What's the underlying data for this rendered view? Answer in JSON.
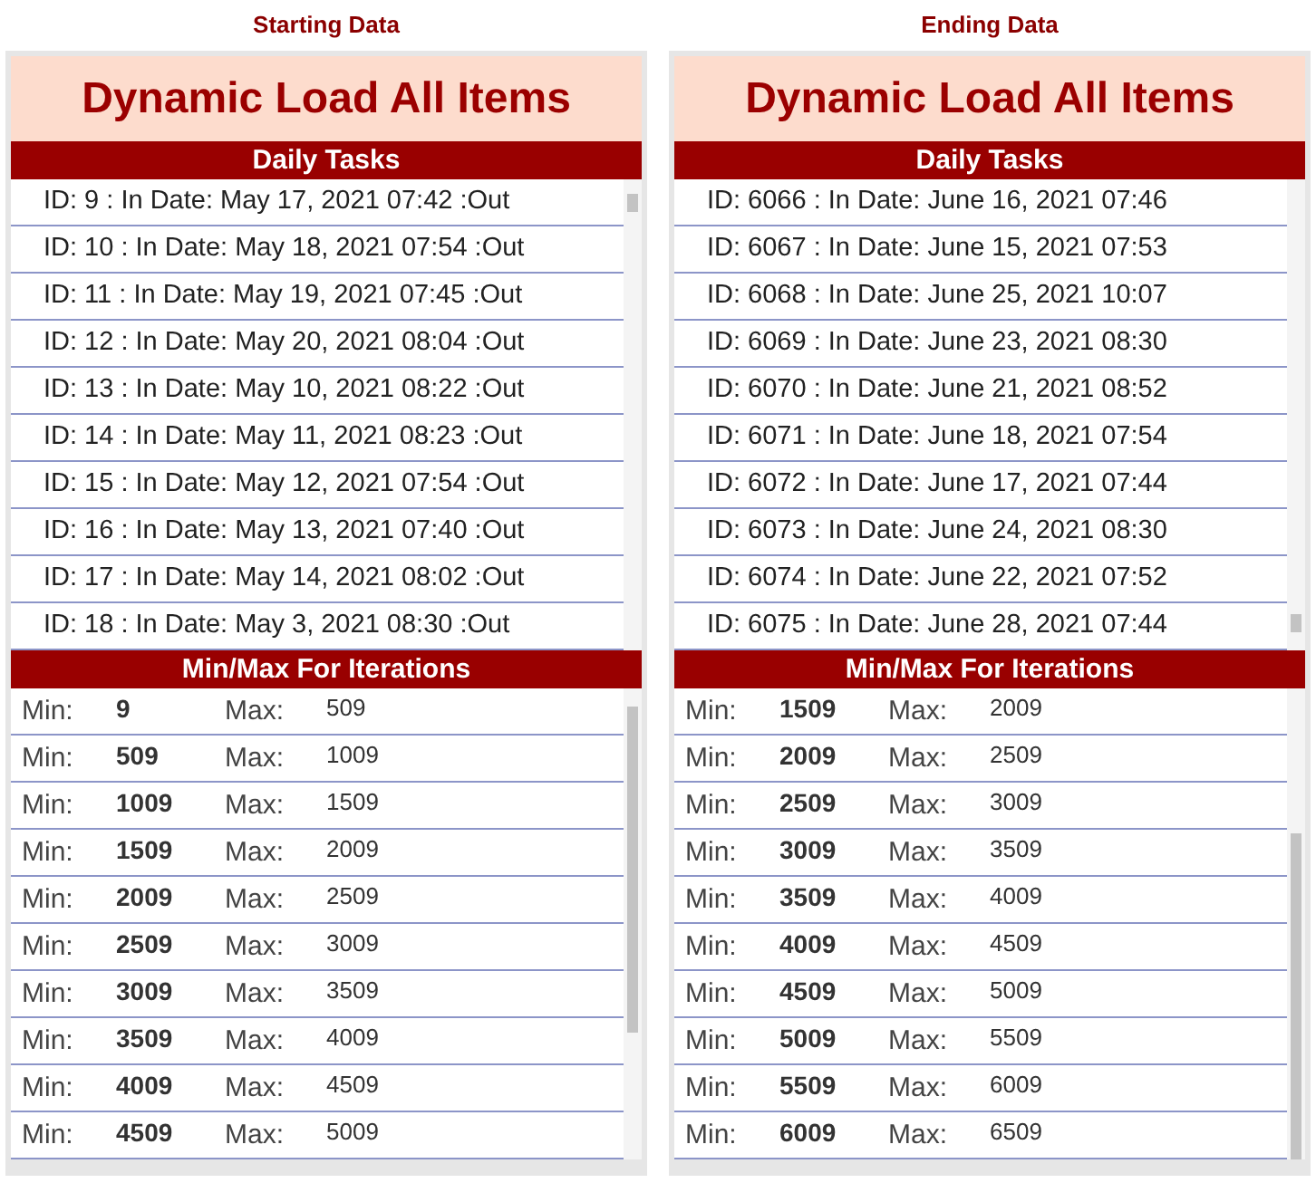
{
  "panels": [
    {
      "caption": "Starting Data",
      "title": "Dynamic Load All Items",
      "tasks_header": "Daily Tasks",
      "tasks": [
        "ID: 9 : In Date: May 17, 2021 07:42 :Out",
        "ID: 10 : In Date: May 18, 2021 07:54 :Out",
        "ID: 11 : In Date: May 19, 2021 07:45 :Out",
        "ID: 12 : In Date: May 20, 2021 08:04 :Out",
        "ID: 13 : In Date: May 10, 2021 08:22 :Out",
        "ID: 14 : In Date: May 11, 2021 08:23 :Out",
        "ID: 15 : In Date: May 12, 2021 07:54 :Out",
        "ID: 16 : In Date: May 13, 2021 07:40 :Out",
        "ID: 17 : In Date: May 14, 2021 08:02 :Out",
        "ID: 18 : In Date: May 3, 2021 08:30 :Out"
      ],
      "iterations_header": "Min/Max For Iterations",
      "iterations": [
        {
          "min_label": "Min:",
          "min": "9",
          "max_label": "Max:",
          "max": "509"
        },
        {
          "min_label": "Min:",
          "min": "509",
          "max_label": "Max:",
          "max": "1009"
        },
        {
          "min_label": "Min:",
          "min": "1009",
          "max_label": "Max:",
          "max": "1509"
        },
        {
          "min_label": "Min:",
          "min": "1509",
          "max_label": "Max:",
          "max": "2009"
        },
        {
          "min_label": "Min:",
          "min": "2009",
          "max_label": "Max:",
          "max": "2509"
        },
        {
          "min_label": "Min:",
          "min": "2509",
          "max_label": "Max:",
          "max": "3009"
        },
        {
          "min_label": "Min:",
          "min": "3009",
          "max_label": "Max:",
          "max": "3509"
        },
        {
          "min_label": "Min:",
          "min": "3509",
          "max_label": "Max:",
          "max": "4009"
        },
        {
          "min_label": "Min:",
          "min": "4009",
          "max_label": "Max:",
          "max": "4509"
        },
        {
          "min_label": "Min:",
          "min": "4509",
          "max_label": "Max:",
          "max": "5009"
        }
      ]
    },
    {
      "caption": "Ending Data",
      "title": "Dynamic Load All Items",
      "tasks_header": "Daily Tasks",
      "tasks": [
        "ID: 6066 : In Date: June 16, 2021 07:46",
        "ID: 6067 : In Date: June 15, 2021 07:53",
        "ID: 6068 : In Date: June 25, 2021 10:07",
        "ID: 6069 : In Date: June 23, 2021 08:30",
        "ID: 6070 : In Date: June 21, 2021 08:52",
        "ID: 6071 : In Date: June 18, 2021 07:54",
        "ID: 6072 : In Date: June 17, 2021 07:44",
        "ID: 6073 : In Date: June 24, 2021 08:30",
        "ID: 6074 : In Date: June 22, 2021 07:52",
        "ID: 6075 : In Date: June 28, 2021 07:44"
      ],
      "iterations_header": "Min/Max For Iterations",
      "iterations": [
        {
          "min_label": "Min:",
          "min": "1509",
          "max_label": "Max:",
          "max": "2009"
        },
        {
          "min_label": "Min:",
          "min": "2009",
          "max_label": "Max:",
          "max": "2509"
        },
        {
          "min_label": "Min:",
          "min": "2509",
          "max_label": "Max:",
          "max": "3009"
        },
        {
          "min_label": "Min:",
          "min": "3009",
          "max_label": "Max:",
          "max": "3509"
        },
        {
          "min_label": "Min:",
          "min": "3509",
          "max_label": "Max:",
          "max": "4009"
        },
        {
          "min_label": "Min:",
          "min": "4009",
          "max_label": "Max:",
          "max": "4509"
        },
        {
          "min_label": "Min:",
          "min": "4509",
          "max_label": "Max:",
          "max": "5009"
        },
        {
          "min_label": "Min:",
          "min": "5009",
          "max_label": "Max:",
          "max": "5509"
        },
        {
          "min_label": "Min:",
          "min": "5509",
          "max_label": "Max:",
          "max": "6009"
        },
        {
          "min_label": "Min:",
          "min": "6009",
          "max_label": "Max:",
          "max": "6509"
        }
      ]
    }
  ]
}
